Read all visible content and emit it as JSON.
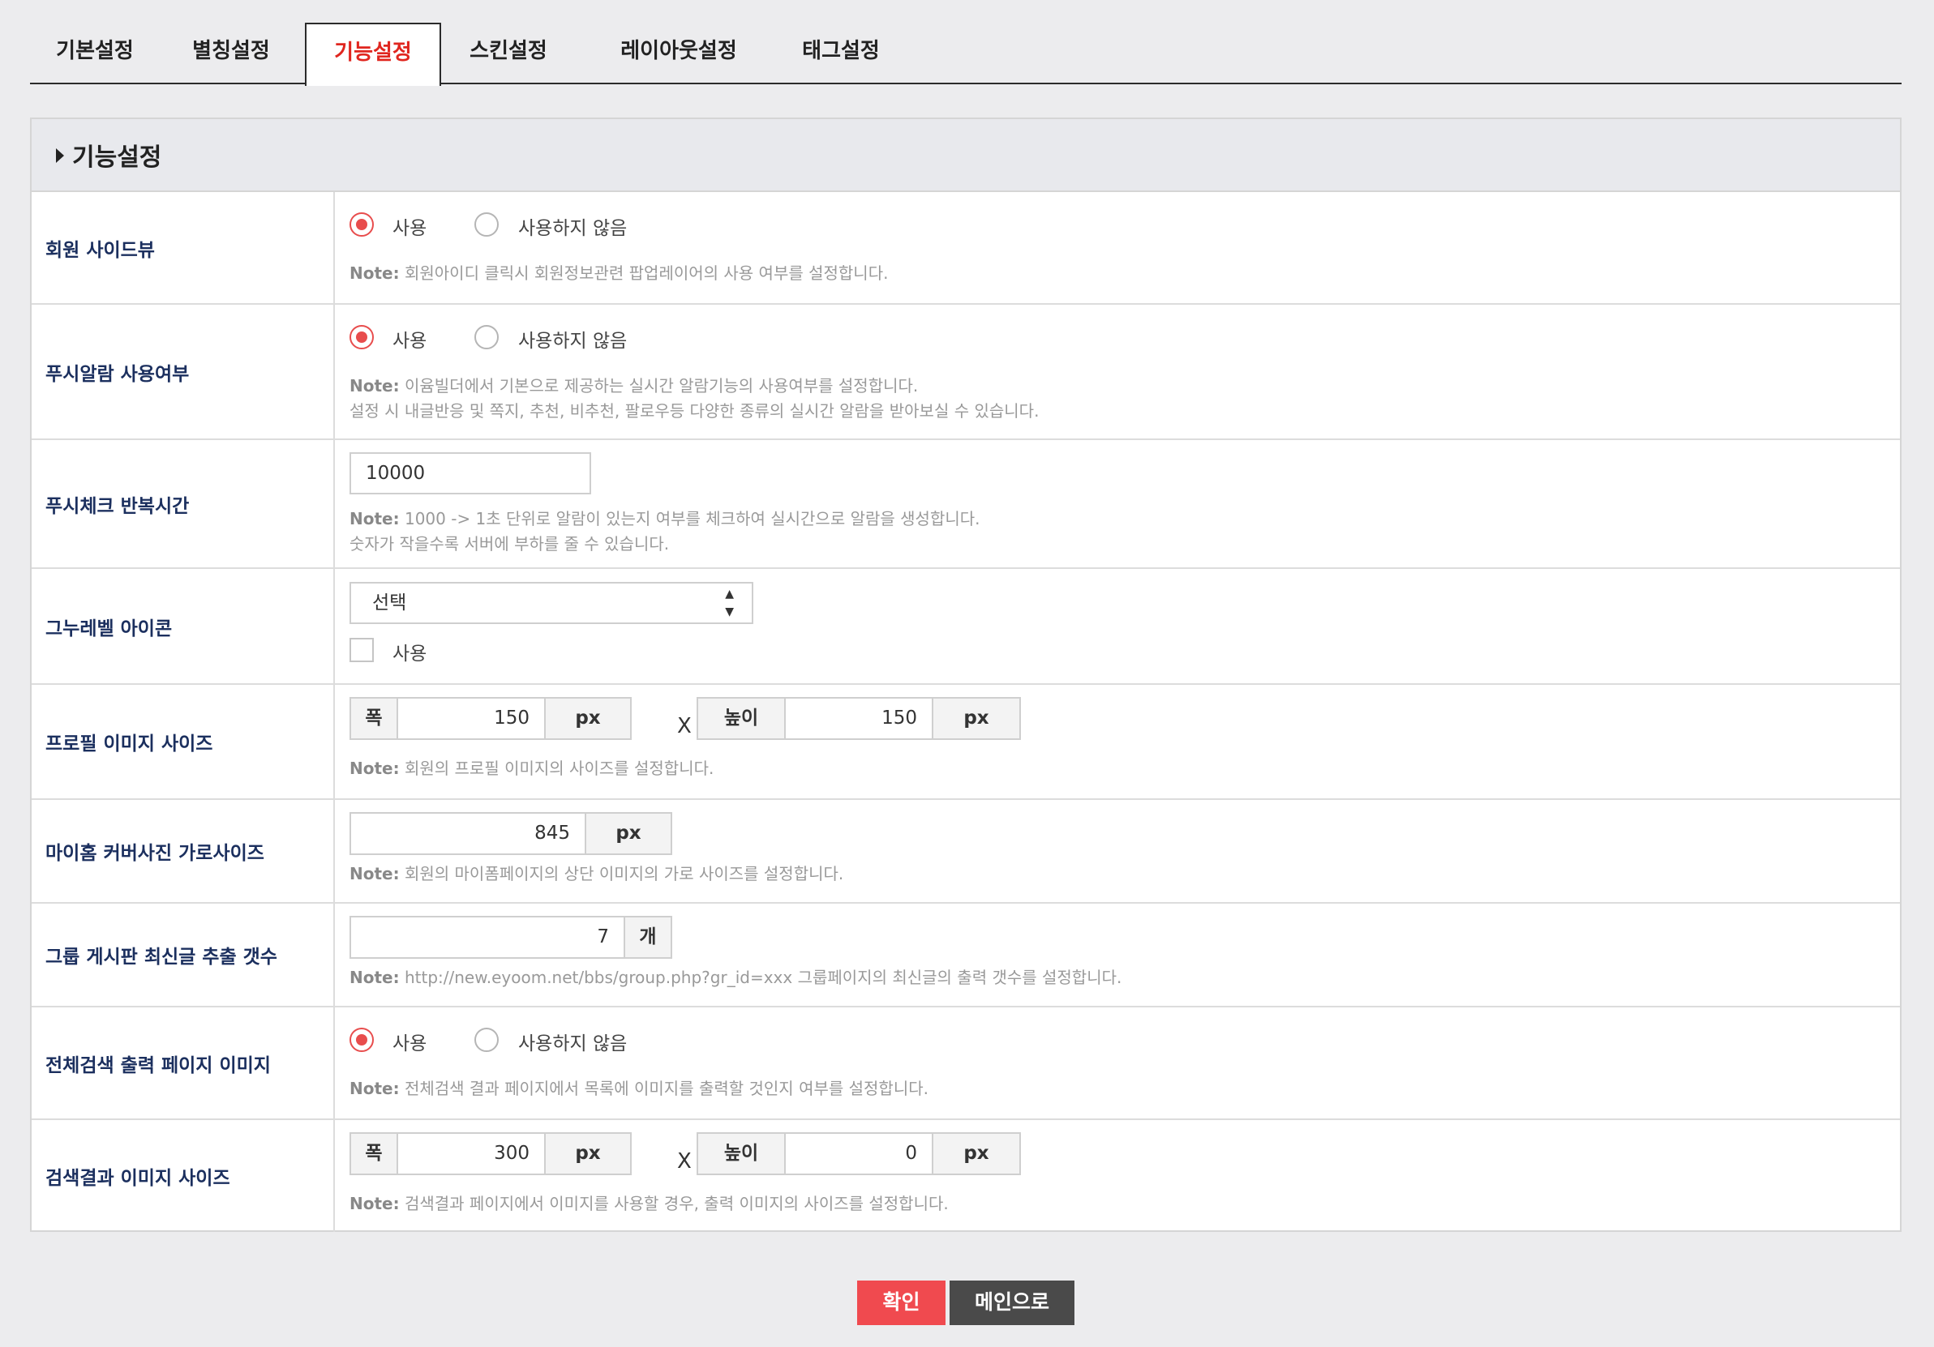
{
  "tabs": [
    "기본설정",
    "별칭설정",
    "기능설정",
    "스킨설정",
    "레이아웃설정",
    "태그설정"
  ],
  "panel": {
    "title": "기능설정"
  },
  "common": {
    "use": "사용",
    "not_use": "사용하지 않음",
    "note_label": "Note:",
    "px": "px",
    "width": "폭",
    "height": "높이",
    "x": "X"
  },
  "rows": {
    "side_view": {
      "label": "회원 사이드뷰",
      "selected": "사용",
      "note": " 회원아이디 클릭시 회원정보관련 팝업레이어의 사용 여부를 설정합니다."
    },
    "push_alarm": {
      "label": "푸시알람 사용여부",
      "selected": "사용",
      "note1": " 이윰빌더에서 기본으로 제공하는 실시간 알람기능의 사용여부를 설정합니다.",
      "note2": "설정 시 내글반응 및 쪽지, 추천, 비추천, 팔로우등 다양한 종류의 실시간 알람을 받아보실 수 있습니다."
    },
    "push_interval": {
      "label": "푸시체크 반복시간",
      "value": "10000",
      "note1": " 1000 -> 1초 단위로 알람이 있는지 여부를 체크하여 실시간으로 알람을 생성합니다.",
      "note2": "숫자가 작을수록 서버에 부하를 줄 수 있습니다."
    },
    "level_icon": {
      "label": "그누레벨 아이콘",
      "select_value": "선택",
      "checkbox_label": "사용",
      "checked": false
    },
    "profile_size": {
      "label": "프로필 이미지 사이즈",
      "width": "150",
      "height": "150",
      "note": " 회원의 프로필 이미지의 사이즈를 설정합니다."
    },
    "cover_width": {
      "label": "마이홈 커버사진 가로사이즈",
      "value": "845",
      "note": " 회원의 마이폼페이지의 상단 이미지의 가로 사이즈를 설정합니다."
    },
    "group_latest": {
      "label": "그룹 게시판 최신글 추출 갯수",
      "value": "7",
      "unit": "개",
      "note": " http://new.eyoom.net/bbs/group.php?gr_id=xxx 그룹페이지의 최신글의 출력 갯수를 설정합니다."
    },
    "search_image": {
      "label": "전체검색 출력 페이지 이미지",
      "selected": "사용",
      "note": " 전체검색 결과 페이지에서 목록에 이미지를 출력할 것인지 여부를 설정합니다."
    },
    "search_image_size": {
      "label": "검색결과 이미지 사이즈",
      "width": "300",
      "height": "0",
      "note": " 검색결과 페이지에서 이미지를 사용할 경우, 출력 이미지의 사이즈를 설정합니다."
    }
  },
  "buttons": {
    "confirm": "확인",
    "main": "메인으로"
  },
  "colors": {
    "accent": "#e84d4d",
    "label": "#1b2f5e",
    "confirm_bg": "#f04a4f",
    "main_bg": "#4a4a4a"
  }
}
